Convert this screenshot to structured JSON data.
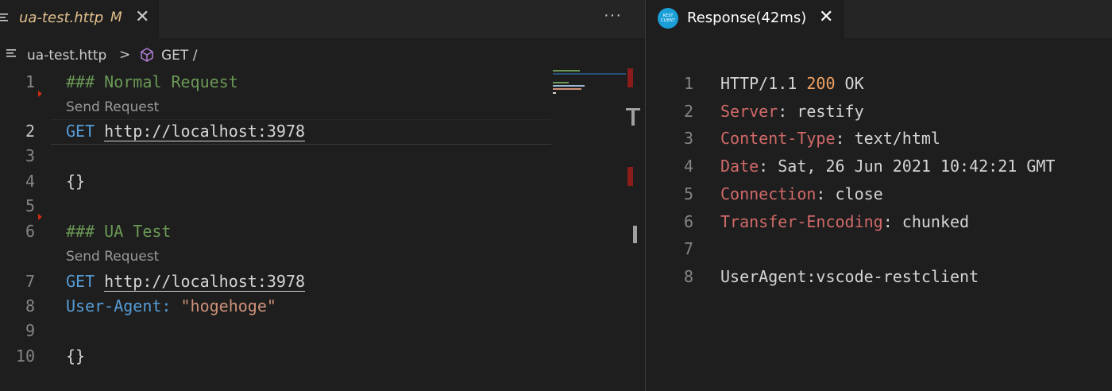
{
  "left_editor": {
    "tab": {
      "title": "ua-test.http",
      "modified_marker": "M",
      "close_glyph": "✕"
    },
    "more_actions_glyph": "···",
    "breadcrumb": {
      "file": "ua-test.http",
      "separator": ">",
      "symbol": "GET /"
    },
    "codelens": [
      "Send Request",
      "Send Request"
    ],
    "lines": [
      {
        "num": "1",
        "text": "### Normal Request"
      },
      {
        "num": "2",
        "method": "GET",
        "url": "http://localhost:3978"
      },
      {
        "num": "3",
        "text": ""
      },
      {
        "num": "4",
        "text": "{}"
      },
      {
        "num": "5",
        "text": ""
      },
      {
        "num": "6",
        "text": "### UA Test"
      },
      {
        "num": "7",
        "method": "GET",
        "url": "http://localhost:3978"
      },
      {
        "num": "8",
        "header_name": "User-Agent:",
        "header_value": "\"hogehoge\""
      },
      {
        "num": "9",
        "text": ""
      },
      {
        "num": "10",
        "text": "{}"
      }
    ]
  },
  "right_editor": {
    "tab": {
      "title": "Response(42ms)",
      "close_glyph": "✕",
      "icon_text": "REST CLIENT"
    },
    "lines": [
      {
        "num": "1",
        "pre": "HTTP/1.1 ",
        "code": "200",
        "post": " OK"
      },
      {
        "num": "2",
        "name": "Server",
        "value": ": restify"
      },
      {
        "num": "3",
        "name": "Content-Type",
        "value": ": text/html"
      },
      {
        "num": "4",
        "name": "Date",
        "value": ": Sat, 26 Jun 2021 10:42:21 GMT"
      },
      {
        "num": "5",
        "name": "Connection",
        "value": ": close"
      },
      {
        "num": "6",
        "name": "Transfer-Encoding",
        "value": ": chunked"
      },
      {
        "num": "7",
        "plain": ""
      },
      {
        "num": "8",
        "plain": "UserAgent:vscode-restclient"
      }
    ]
  },
  "colors": {
    "comment": "#6a9955",
    "keyword": "#569cd6",
    "string": "#ce9178",
    "header_name": "#d16969",
    "status_code": "#f0a060",
    "modified_tab": "#e2c08d"
  }
}
